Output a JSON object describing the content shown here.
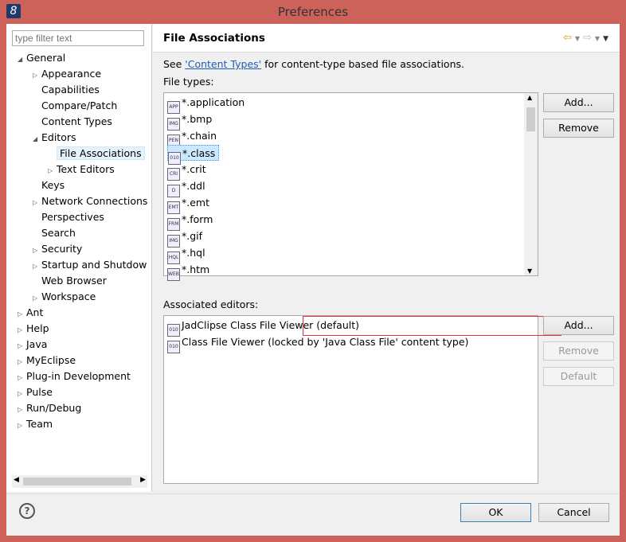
{
  "window": {
    "title": "Preferences",
    "icon": "eclipse-icon"
  },
  "filter": {
    "placeholder": "type filter text"
  },
  "tree": [
    {
      "label": "General",
      "level": 0,
      "arrow": "expanded"
    },
    {
      "label": "Appearance",
      "level": 1,
      "arrow": "collapsed"
    },
    {
      "label": "Capabilities",
      "level": 1,
      "arrow": ""
    },
    {
      "label": "Compare/Patch",
      "level": 1,
      "arrow": ""
    },
    {
      "label": "Content Types",
      "level": 1,
      "arrow": ""
    },
    {
      "label": "Editors",
      "level": 1,
      "arrow": "expanded"
    },
    {
      "label": "File Associations",
      "level": 2,
      "arrow": "",
      "selected": true
    },
    {
      "label": "Text Editors",
      "level": 2,
      "arrow": "collapsed"
    },
    {
      "label": "Keys",
      "level": 1,
      "arrow": ""
    },
    {
      "label": "Network Connections",
      "level": 1,
      "arrow": "collapsed"
    },
    {
      "label": "Perspectives",
      "level": 1,
      "arrow": ""
    },
    {
      "label": "Search",
      "level": 1,
      "arrow": ""
    },
    {
      "label": "Security",
      "level": 1,
      "arrow": "collapsed"
    },
    {
      "label": "Startup and Shutdow",
      "level": 1,
      "arrow": "collapsed"
    },
    {
      "label": "Web Browser",
      "level": 1,
      "arrow": ""
    },
    {
      "label": "Workspace",
      "level": 1,
      "arrow": "collapsed"
    },
    {
      "label": "Ant",
      "level": 0,
      "arrow": "collapsed"
    },
    {
      "label": "Help",
      "level": 0,
      "arrow": "collapsed"
    },
    {
      "label": "Java",
      "level": 0,
      "arrow": "collapsed"
    },
    {
      "label": "MyEclipse",
      "level": 0,
      "arrow": "collapsed"
    },
    {
      "label": "Plug-in Development",
      "level": 0,
      "arrow": "collapsed"
    },
    {
      "label": "Pulse",
      "level": 0,
      "arrow": "collapsed"
    },
    {
      "label": "Run/Debug",
      "level": 0,
      "arrow": "collapsed"
    },
    {
      "label": "Team",
      "level": 0,
      "arrow": "collapsed"
    }
  ],
  "page": {
    "title": "File Associations",
    "desc_pre": "See ",
    "desc_link": "'Content Types'",
    "desc_post": " for content-type based file associations.",
    "file_types_label": "File types:",
    "file_types": [
      {
        "label": "*.application",
        "icon": "APP"
      },
      {
        "label": "*.bmp",
        "icon": "IMG"
      },
      {
        "label": "*.chain",
        "icon": "PEN"
      },
      {
        "label": "*.class",
        "icon": "010",
        "selected": true
      },
      {
        "label": "*.crit",
        "icon": "CRI"
      },
      {
        "label": "*.ddl",
        "icon": "D"
      },
      {
        "label": "*.emt",
        "icon": "EMT"
      },
      {
        "label": "*.form",
        "icon": "FRM"
      },
      {
        "label": "*.gif",
        "icon": "IMG"
      },
      {
        "label": "*.hql",
        "icon": "HQL"
      },
      {
        "label": "*.htm",
        "icon": "WEB"
      }
    ],
    "file_buttons": {
      "add": "Add...",
      "remove": "Remove"
    },
    "editors_label": "Associated editors:",
    "editors": [
      {
        "label": "JadClipse Class File Viewer (default)",
        "icon": "010"
      },
      {
        "label": "Class File Viewer (locked by 'Java Class File' content type)",
        "icon": "010"
      }
    ],
    "editor_buttons": {
      "add": "Add...",
      "remove": "Remove",
      "default": "Default"
    }
  },
  "footer": {
    "ok": "OK",
    "cancel": "Cancel"
  }
}
